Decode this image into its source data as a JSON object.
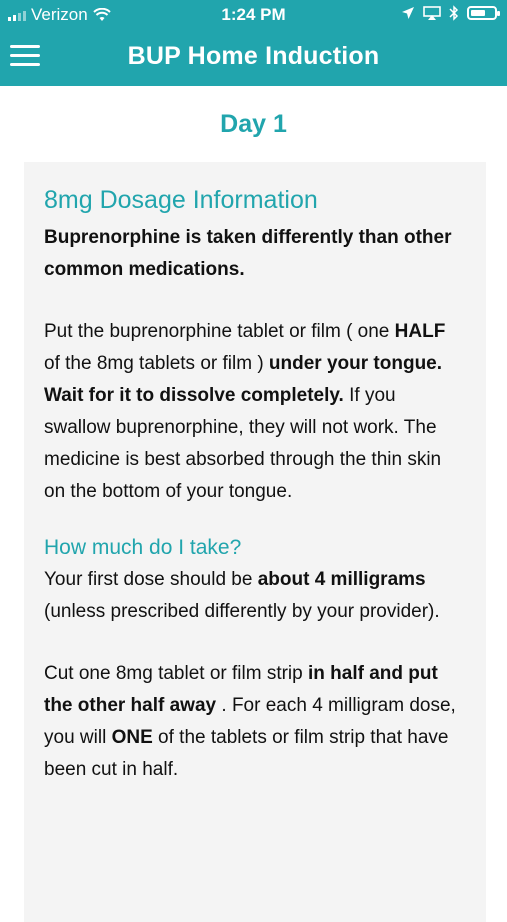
{
  "status_bar": {
    "carrier": "Verizon",
    "time": "1:24 PM"
  },
  "nav": {
    "title": "BUP Home Induction"
  },
  "page": {
    "day_title": "Day 1"
  },
  "card": {
    "heading": "8mg Dosage Information",
    "intro_bold": "Buprenorphine is taken differently than other common medications.",
    "p1_a": "Put the buprenorphine tablet or film ( one ",
    "p1_b": "HALF",
    "p1_c": " of the 8mg tablets or film ) ",
    "p1_d": "under your tongue. Wait for it to dissolve completely.",
    "p1_e": " If you swallow buprenorphine, they will not work. The medicine is best absorbed through the thin skin on the bottom of your tongue.",
    "subheading": "How much do I take?",
    "p2_a": "Your first dose should be ",
    "p2_b": "about 4 milligrams",
    "p2_c": " (unless prescribed differently by your provider).",
    "p3_a": "Cut one 8mg tablet or film strip ",
    "p3_b": "in half and put the other half away",
    "p3_c": " . For each 4 milligram dose, you will  ",
    "p3_d": "ONE",
    "p3_e": " of the tablets or film strip that have been cut in half."
  }
}
